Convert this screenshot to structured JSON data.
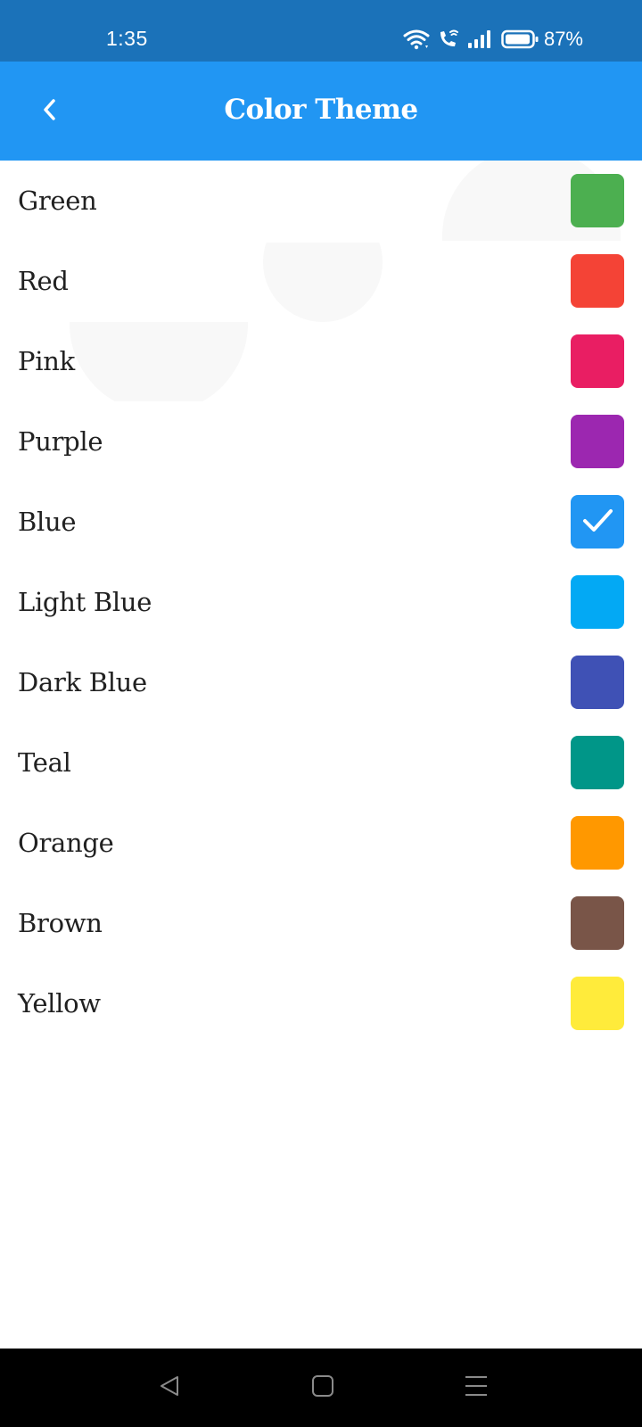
{
  "status_bar": {
    "time": "1:35",
    "battery": "87%",
    "icons": [
      "wifi-icon",
      "wifi-call-icon",
      "signal-icon",
      "battery-icon"
    ]
  },
  "app_bar": {
    "title": "Color Theme",
    "back_icon": "chevron-left-icon"
  },
  "themes": [
    {
      "label": "Green",
      "color": "#4caf50",
      "selected": false
    },
    {
      "label": "Red",
      "color": "#f44336",
      "selected": false
    },
    {
      "label": "Pink",
      "color": "#e91e63",
      "selected": false
    },
    {
      "label": "Purple",
      "color": "#9c27b0",
      "selected": false
    },
    {
      "label": "Blue",
      "color": "#2196f3",
      "selected": true
    },
    {
      "label": "Light Blue",
      "color": "#03a9f4",
      "selected": false
    },
    {
      "label": "Dark Blue",
      "color": "#3f51b5",
      "selected": false
    },
    {
      "label": "Teal",
      "color": "#009688",
      "selected": false
    },
    {
      "label": "Orange",
      "color": "#ff9800",
      "selected": false
    },
    {
      "label": "Brown",
      "color": "#795548",
      "selected": false
    },
    {
      "label": "Yellow",
      "color": "#ffeb3b",
      "selected": false
    }
  ],
  "nav_bar": {
    "icons": [
      "back-triangle-icon",
      "home-square-icon",
      "recents-menu-icon"
    ]
  },
  "colors": {
    "status_bar": "#1b72b9",
    "app_bar": "#2196f3",
    "nav_bar": "#000000"
  }
}
